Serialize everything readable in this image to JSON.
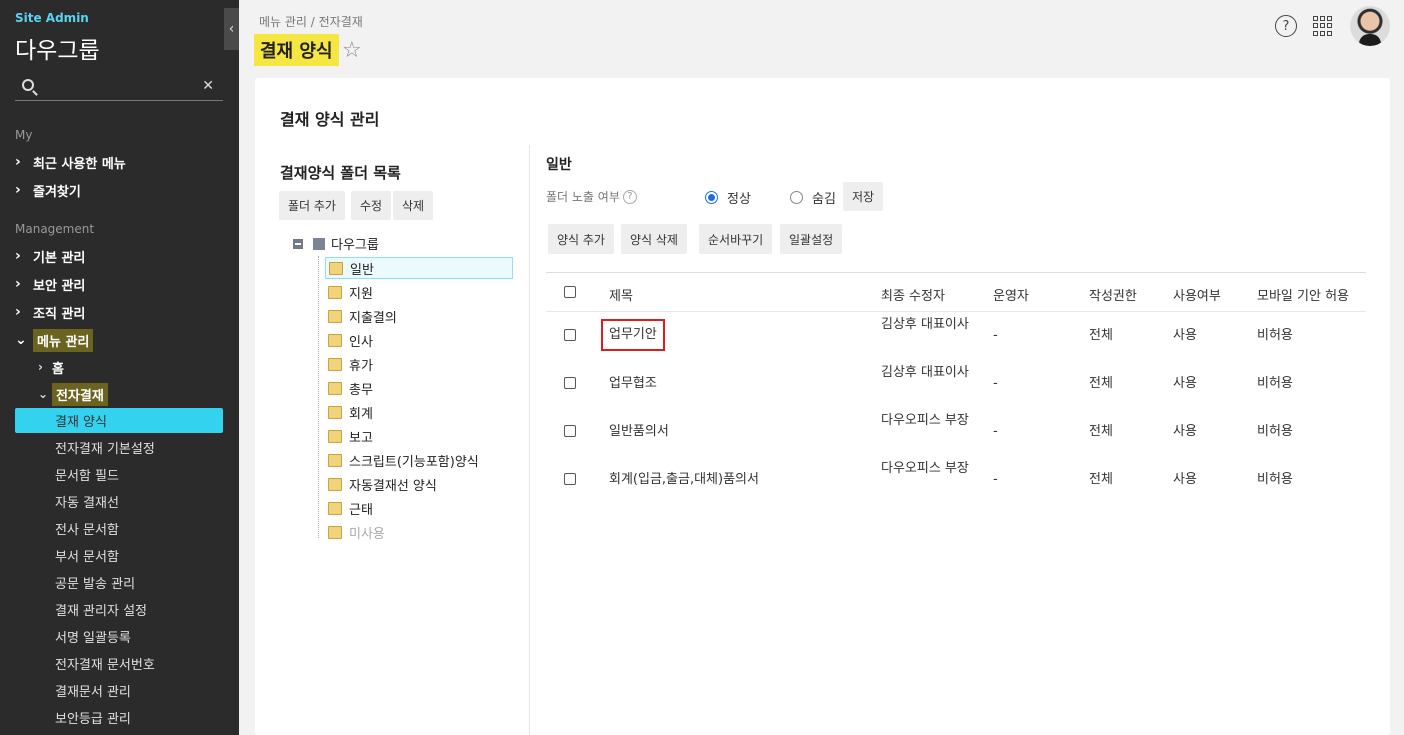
{
  "sidebar": {
    "site_label": "Site Admin",
    "org_name": "다우그룹",
    "search_placeholder": "",
    "section_my": "My",
    "my_items": [
      {
        "label": "최근 사용한 메뉴"
      },
      {
        "label": "즐겨찾기"
      }
    ],
    "section_management": "Management",
    "mgmt_items": [
      {
        "label": "기본 관리"
      },
      {
        "label": "보안 관리"
      },
      {
        "label": "조직 관리"
      },
      {
        "label": "메뉴 관리"
      }
    ],
    "menu_sub": [
      {
        "label": "홈"
      },
      {
        "label": "전자결재"
      }
    ],
    "leaves": [
      {
        "label": "결재 양식"
      },
      {
        "label": "전자결재 기본설정"
      },
      {
        "label": "문서함 필드"
      },
      {
        "label": "자동 결재선"
      },
      {
        "label": "전사 문서함"
      },
      {
        "label": "부서 문서함"
      },
      {
        "label": "공문 발송 관리"
      },
      {
        "label": "결재 관리자 설정"
      },
      {
        "label": "서명 일괄등록"
      },
      {
        "label": "전자결재 문서번호"
      },
      {
        "label": "결재문서 관리"
      },
      {
        "label": "보안등급 관리"
      }
    ]
  },
  "header": {
    "breadcrumb": "메뉴 관리 / 전자결재",
    "title": "결재 양식",
    "help": "?"
  },
  "panel": {
    "title": "결재 양식 관리",
    "folder_list_title": "결재양식 폴더 목록",
    "folder_buttons": {
      "add": "폴더 추가",
      "edit": "수정",
      "delete": "삭제"
    },
    "tree_root": "다우그룹",
    "tree_nodes": [
      {
        "label": "일반"
      },
      {
        "label": "지원"
      },
      {
        "label": "지출결의"
      },
      {
        "label": "인사"
      },
      {
        "label": "휴가"
      },
      {
        "label": "총무"
      },
      {
        "label": "회계"
      },
      {
        "label": "보고"
      },
      {
        "label": "스크립트(기능포함)양식"
      },
      {
        "label": "자동결재선 양식"
      },
      {
        "label": "근태"
      },
      {
        "label": "미사용"
      }
    ],
    "category_title": "일반",
    "expose_label": "폴더 노출 여부",
    "radio_normal": "정상",
    "radio_hidden": "숨김",
    "save_label": "저장",
    "form_buttons": {
      "add": "양식 추가",
      "delete": "양식 삭제",
      "reorder": "순서바꾸기",
      "bulk": "일괄설정"
    },
    "columns": [
      "제목",
      "최종 수정자",
      "운영자",
      "작성권한",
      "사용여부",
      "모바일 기안 허용"
    ],
    "rows": [
      {
        "title": "업무기안",
        "modifier": "김상후 대표이사",
        "operator": "-",
        "permission": "전체",
        "use": "사용",
        "mobile": "비허용"
      },
      {
        "title": "업무협조",
        "modifier": "김상후 대표이사",
        "operator": "-",
        "permission": "전체",
        "use": "사용",
        "mobile": "비허용"
      },
      {
        "title": "일반품의서",
        "modifier": "다우오피스 부장",
        "operator": "-",
        "permission": "전체",
        "use": "사용",
        "mobile": "비허용"
      },
      {
        "title": "회계(입금,출금,대체)품의서",
        "modifier": "다우오피스 부장",
        "operator": "-",
        "permission": "전체",
        "use": "사용",
        "mobile": "비허용"
      }
    ]
  },
  "colors": {
    "accent": "#33d3ef",
    "title_highlight": "#f5e642",
    "menu_highlight": "#6b6420",
    "selected_border": "#d81e1e"
  }
}
